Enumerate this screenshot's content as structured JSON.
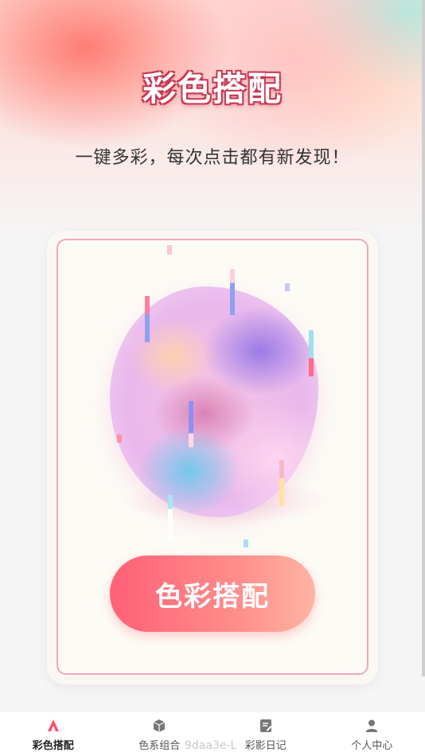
{
  "header": {
    "title": "彩色搭配",
    "subtitle": "一键多彩，每次点击都有新发现！"
  },
  "main": {
    "action_button_label": "色彩搭配",
    "illustration_name": "color-blob-illustration"
  },
  "tabbar": {
    "tabs": [
      {
        "label": "彩色搭配",
        "icon": "palette-icon",
        "active": true
      },
      {
        "label": "色系组合",
        "icon": "cube-icon",
        "active": false
      },
      {
        "label": "彩影日记",
        "icon": "notebook-icon",
        "active": false
      },
      {
        "label": "个人中心",
        "icon": "user-icon",
        "active": false
      }
    ]
  },
  "watermark": "9daa3e-L",
  "colors": {
    "accent": "#ff6077",
    "frame": "#f2a6bd",
    "title_stroke": "#c73a55",
    "active_icon": "#ff4d6a"
  }
}
